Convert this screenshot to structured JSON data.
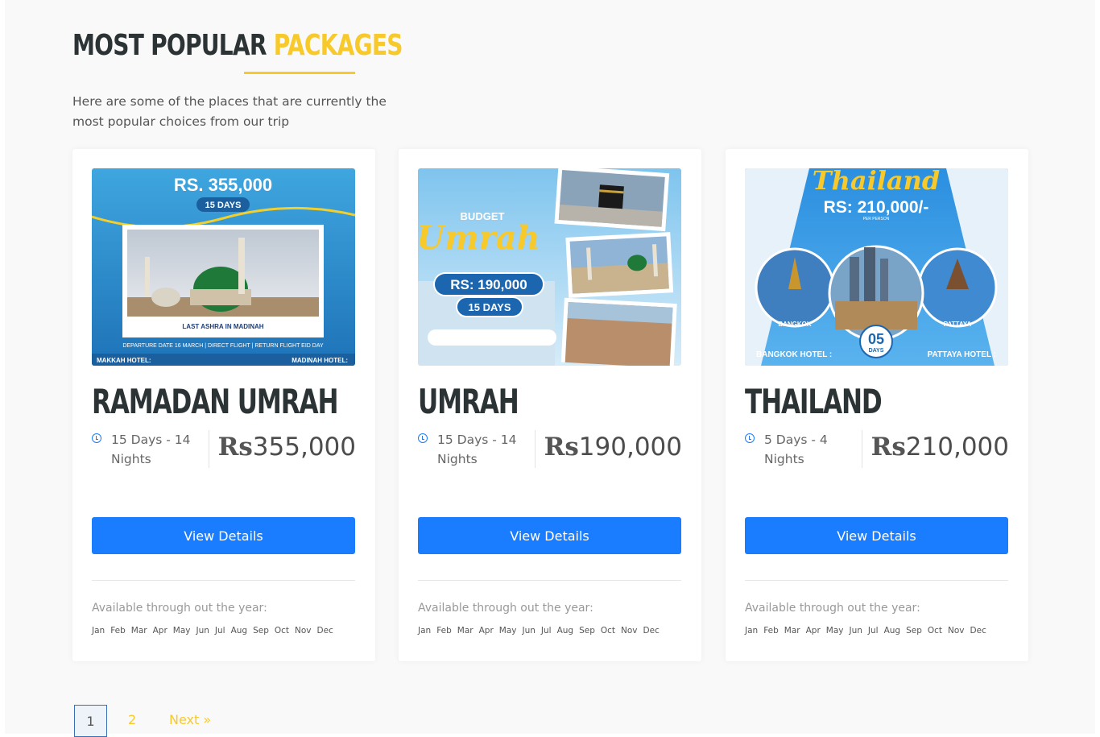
{
  "section": {
    "title_main": "MOST POPULAR",
    "title_highlight": "PACKAGES",
    "subtitle": "Here are some of the places that are currently the most popular choices from our trip"
  },
  "colors": {
    "accent": "#f7c92b",
    "primary": "#1a7cff",
    "dark": "#2c3335"
  },
  "packages": [
    {
      "title": "RAMADAN UMRAH",
      "duration": "15 Days - 14 Nights",
      "price_symbol": "Rs",
      "price_value": "355,000",
      "button": "View Details",
      "availability": "Available through out the year:",
      "image": {
        "price": "RS. 355,000",
        "days": "15 DAYS",
        "caption": "LAST ASHRA IN MADINAH",
        "info_line": "DEPARTURE DATE 16 MARCH  |  DIRECT FLIGHT  |  RETURN FLIGHT EID DAY",
        "hotel_left": "MAKKAH HOTEL:",
        "hotel_right": "MADINAH HOTEL:"
      }
    },
    {
      "title": "UMRAH",
      "duration": "15 Days - 14 Nights",
      "price_symbol": "Rs",
      "price_value": "190,000",
      "button": "View Details",
      "availability": "Available through out the year:",
      "image": {
        "budget": "BUDGET",
        "script": "Umrah",
        "price": "RS: 190,000",
        "days": "15 DAYS"
      }
    },
    {
      "title": "THAILAND",
      "duration": "5 Days - 4 Nights",
      "price_symbol": "Rs",
      "price_value": "210,000",
      "button": "View Details",
      "availability": "Available through out the year:",
      "image": {
        "script": "Thailand",
        "price": "RS: 210,000/-",
        "per_person": "PER PERSON",
        "city_left": "BANGKOK",
        "city_right": "PATTAYA",
        "days_num": "05",
        "days_label": "DAYS",
        "hotel_left": "BANGKOK HOTEL :",
        "hotel_right": "PATTAYA HOTEL :"
      }
    }
  ],
  "months": [
    "Jan",
    "Feb",
    "Mar",
    "Apr",
    "May",
    "Jun",
    "Jul",
    "Aug",
    "Sep",
    "Oct",
    "Nov",
    "Dec"
  ],
  "pagination": {
    "current": "1",
    "page2": "2",
    "next": "Next »"
  }
}
